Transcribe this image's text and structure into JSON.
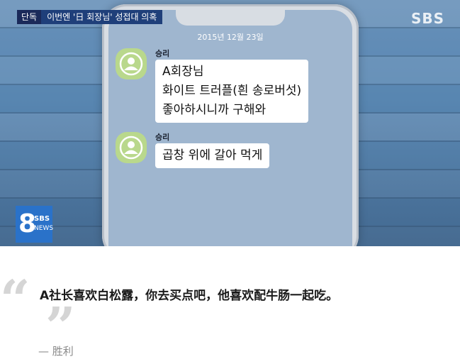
{
  "video": {
    "headline_badge": "단독",
    "headline_text": "이번엔 '日 회장님' 성접대 의혹",
    "broadcaster_logo": "SBS",
    "corner_logo": {
      "number": "8",
      "name": "SBS",
      "sub": "NEWS"
    }
  },
  "chat": {
    "date": "2015년 12월 23일",
    "messages": [
      {
        "sender": "승리",
        "lines": [
          "A회장님",
          "화이트 트러플(흰 송로버섯)",
          "좋아하시니까 구해와"
        ]
      },
      {
        "sender": "승리",
        "lines": [
          "곱창 위에 갈아 먹게"
        ]
      }
    ],
    "avatar_icon": "default-profile-icon"
  },
  "quote": {
    "open_mark": "“",
    "close_mark": "”",
    "text": "A社长喜欢白松露，你去买点吧，他喜欢配牛肠一起吃。",
    "author": "— 胜利"
  }
}
